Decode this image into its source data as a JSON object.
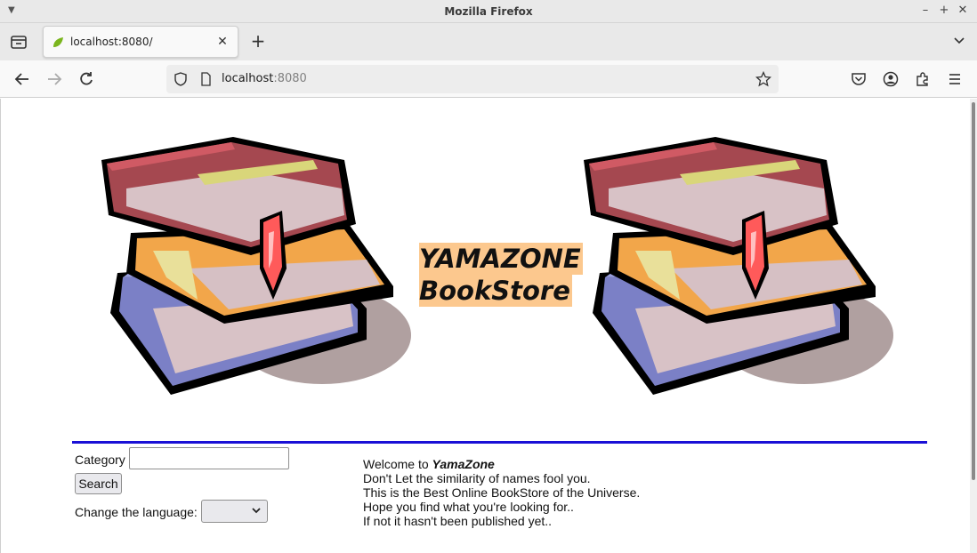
{
  "window": {
    "title": "Mozilla Firefox"
  },
  "tabs": [
    {
      "title": "localhost:8080/"
    }
  ],
  "urlbar": {
    "host": "localhost",
    "port": ":8080"
  },
  "page": {
    "brand_line1": "YAMAZONE",
    "brand_line2": "BookStore",
    "category_label": "Category",
    "category_value": "",
    "search_button": "Search",
    "language_label": "Change the language:",
    "language_selected": "",
    "welcome_prefix": "Welcome to ",
    "welcome_brand": "YamaZone",
    "welcome_lines": [
      "Don't Let the similarity of names fool you.",
      "This is the Best Online BookStore of the Universe.",
      "Hope you find what you're looking for..",
      "If not it hasn't been published yet.."
    ]
  },
  "colors": {
    "brand_highlight": "#fcc88e",
    "divider": "#1a10d6"
  }
}
